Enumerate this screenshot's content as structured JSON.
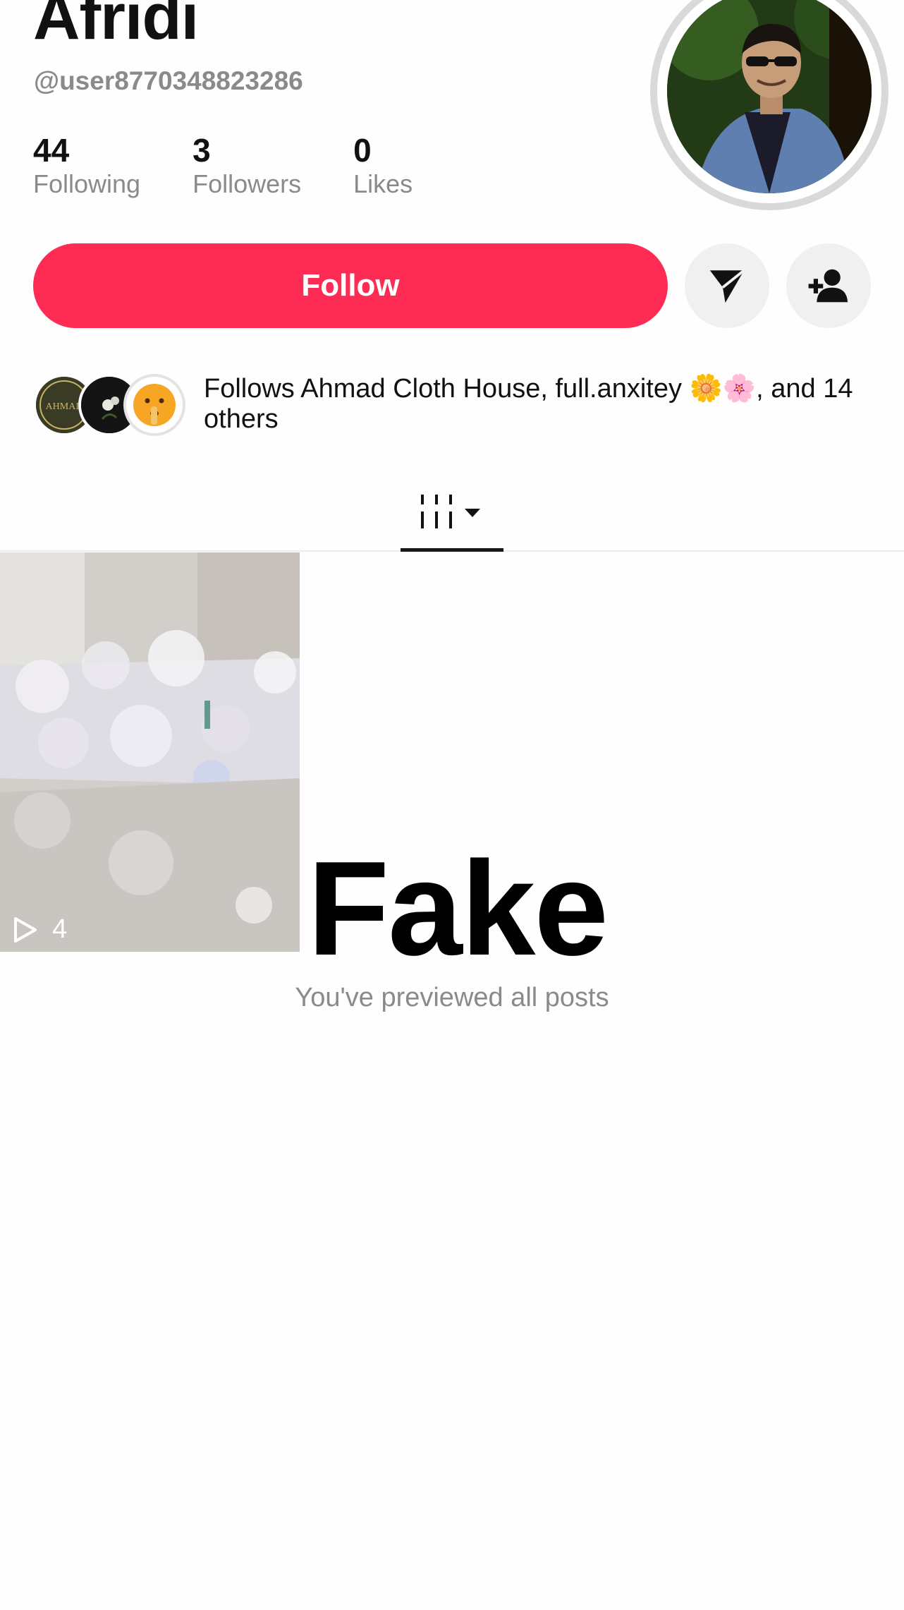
{
  "profile": {
    "display_name": "Afridi",
    "username": "@user8770348823286",
    "stats": [
      {
        "value": "44",
        "label": "Following"
      },
      {
        "value": "3",
        "label": "Followers"
      },
      {
        "value": "0",
        "label": "Likes"
      }
    ]
  },
  "actions": {
    "follow_label": "Follow",
    "message_icon": "paper-plane-icon",
    "suggest_icon": "add-friend-icon"
  },
  "mutuals": {
    "text": "Follows Ahmad Cloth House, full.anxitey 🌼🌸, and 14 others",
    "avatar1_text": "AHMAD"
  },
  "tabs": {
    "active_icon": "grid-icon"
  },
  "videos": [
    {
      "views": "4"
    }
  ],
  "overlay": {
    "text": "Fake"
  },
  "footer": {
    "text": "You've previewed all posts"
  },
  "colors": {
    "accent": "#fe2c55",
    "muted_text": "#8a8a8a"
  }
}
